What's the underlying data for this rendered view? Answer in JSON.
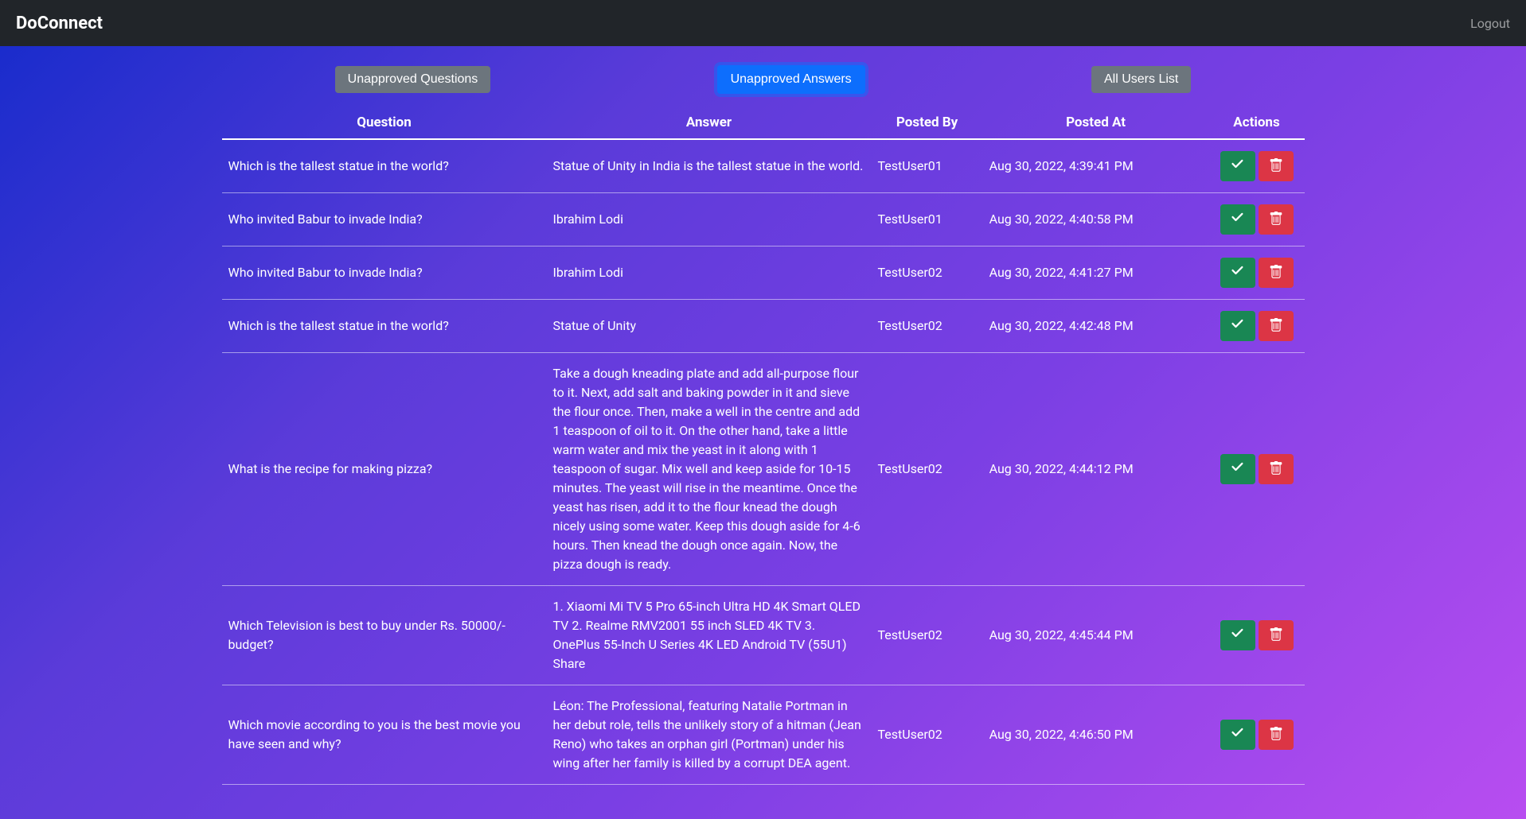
{
  "navbar": {
    "brand": "DoConnect",
    "logout": "Logout"
  },
  "tabs": {
    "unapproved_questions": "Unapproved Questions",
    "unapproved_answers": "Unapproved Answers",
    "all_users": "All Users List"
  },
  "table": {
    "headers": {
      "question": "Question",
      "answer": "Answer",
      "posted_by": "Posted By",
      "posted_at": "Posted At",
      "actions": "Actions"
    },
    "rows": [
      {
        "question": "Which is the tallest statue in the world?",
        "answer": "Statue of Unity in India is the tallest statue in the world.",
        "posted_by": "TestUser01",
        "posted_at": "Aug 30, 2022, 4:39:41 PM"
      },
      {
        "question": "Who invited Babur to invade India?",
        "answer": "Ibrahim Lodi",
        "posted_by": "TestUser01",
        "posted_at": "Aug 30, 2022, 4:40:58 PM"
      },
      {
        "question": "Who invited Babur to invade India?",
        "answer": "Ibrahim Lodi",
        "posted_by": "TestUser02",
        "posted_at": "Aug 30, 2022, 4:41:27 PM"
      },
      {
        "question": "Which is the tallest statue in the world?",
        "answer": "Statue of Unity",
        "posted_by": "TestUser02",
        "posted_at": "Aug 30, 2022, 4:42:48 PM"
      },
      {
        "question": "What is the recipe for making pizza?",
        "answer": "Take a dough kneading plate and add all-purpose flour to it. Next, add salt and baking powder in it and sieve the flour once. Then, make a well in the centre and add 1 teaspoon of oil to it. On the other hand, take a little warm water and mix the yeast in it along with 1 teaspoon of sugar. Mix well and keep aside for 10-15 minutes. The yeast will rise in the meantime. Once the yeast has risen, add it to the flour knead the dough nicely using some water. Keep this dough aside for 4-6 hours. Then knead the dough once again. Now, the pizza dough is ready.",
        "posted_by": "TestUser02",
        "posted_at": "Aug 30, 2022, 4:44:12 PM"
      },
      {
        "question": "Which Television is best to buy under Rs. 50000/- budget?",
        "answer": "1. Xiaomi Mi TV 5 Pro 65-inch Ultra HD 4K Smart QLED TV 2. Realme RMV2001 55 inch SLED 4K TV 3. OnePlus 55-Inch U Series 4K LED Android TV (55U1) Share",
        "posted_by": "TestUser02",
        "posted_at": "Aug 30, 2022, 4:45:44 PM"
      },
      {
        "question": "Which movie according to you is the best movie you have seen and why?",
        "answer": "Léon: The Professional, featuring Natalie Portman in her debut role, tells the unlikely story of a hitman (Jean Reno) who takes an orphan girl (Portman) under his wing after her family is killed by a corrupt DEA agent.",
        "posted_by": "TestUser02",
        "posted_at": "Aug 30, 2022, 4:46:50 PM"
      }
    ]
  }
}
